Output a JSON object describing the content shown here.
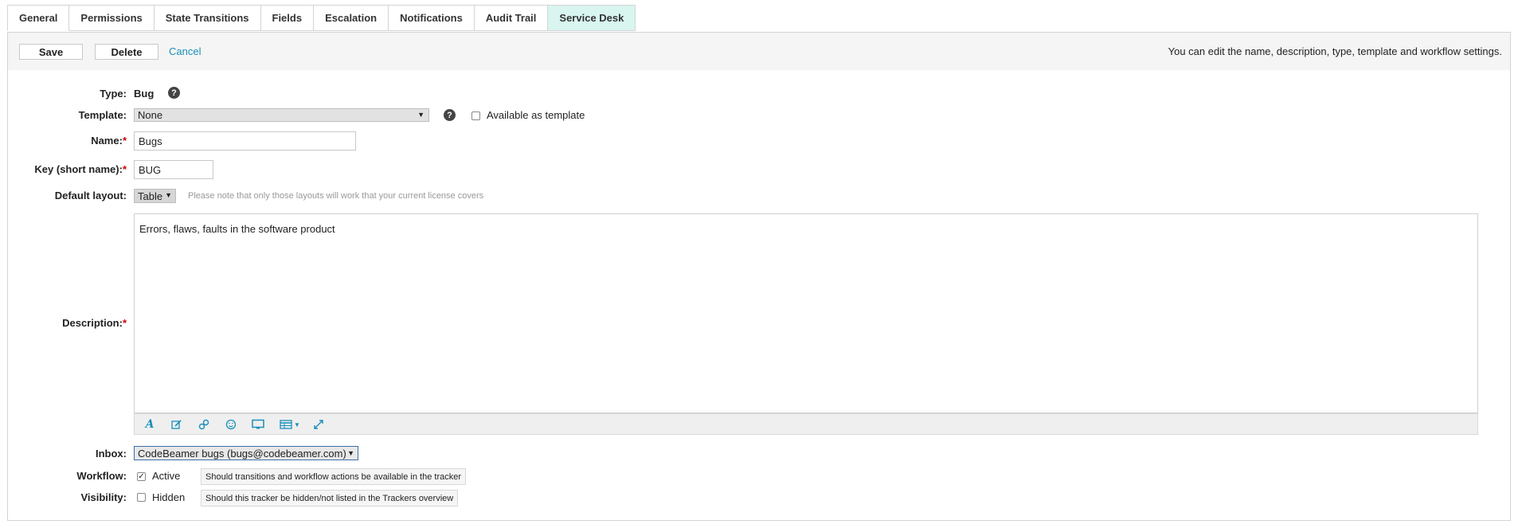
{
  "tabs": [
    {
      "label": "General"
    },
    {
      "label": "Permissions"
    },
    {
      "label": "State Transitions"
    },
    {
      "label": "Fields"
    },
    {
      "label": "Escalation"
    },
    {
      "label": "Notifications"
    },
    {
      "label": "Audit Trail"
    },
    {
      "label": "Service Desk"
    }
  ],
  "actions": {
    "save_label": "Save",
    "delete_label": "Delete",
    "cancel_label": "Cancel",
    "hint": "You can edit the name, description, type, template and workflow settings."
  },
  "form": {
    "type": {
      "label": "Type:",
      "value": "Bug"
    },
    "template": {
      "label": "Template:",
      "value": "None",
      "available_label": "Available as template",
      "available_checked": false
    },
    "name": {
      "label": "Name:",
      "value": "Bugs"
    },
    "key": {
      "label": "Key (short name):",
      "value": "BUG"
    },
    "default_layout": {
      "label": "Default layout:",
      "value": "Table",
      "note": "Please note that only those layouts will work that your current license covers"
    },
    "description": {
      "label": "Description:",
      "value": "Errors, flaws, faults in the software product"
    },
    "inbox": {
      "label": "Inbox:",
      "value": "CodeBeamer bugs (bugs@codebeamer.com)"
    },
    "workflow": {
      "label": "Workflow:",
      "checkbox_label": "Active",
      "checked": true,
      "note": "Should transitions and workflow actions be available in the tracker"
    },
    "visibility": {
      "label": "Visibility:",
      "checkbox_label": "Hidden",
      "checked": false,
      "note": "Should this tracker be hidden/not listed in the Trackers overview"
    }
  },
  "required_marker": "*",
  "help_glyph": "?",
  "editor_toolbar": [
    "text-format-icon",
    "edit-icon",
    "link-icon",
    "emoji-icon",
    "monitor-icon",
    "table-icon",
    "fullscreen-icon"
  ],
  "colors": {
    "link": "#1a8fb8",
    "service_tab_bg": "#d9f5f0",
    "required": "#cc0000"
  }
}
